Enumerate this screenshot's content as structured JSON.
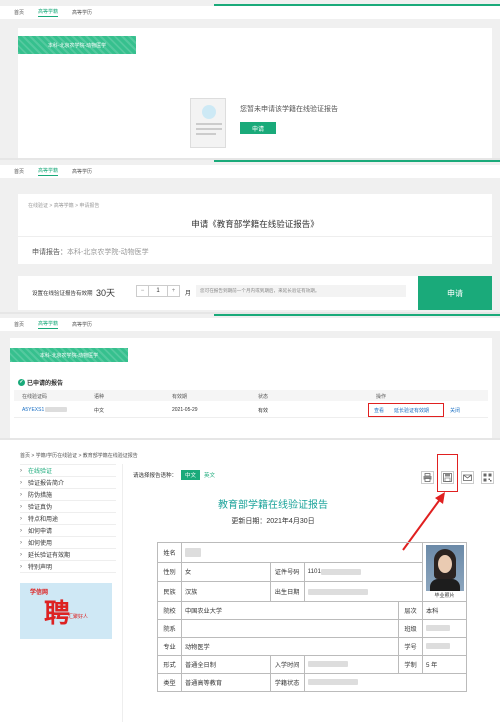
{
  "panel1": {
    "nav": [
      "首页",
      "高等学籍",
      "高等学历"
    ],
    "badge": "本科-北京农学院-动物医学",
    "empty_text": "您暂未申请该学籍在线验证报告",
    "apply_button": "申请"
  },
  "panel2": {
    "nav": [
      "首页",
      "高等学籍",
      "高等学历"
    ],
    "breadcrumb": "在线验证 > 高等学籍 > 申请报告",
    "title": "申请《教育部学籍在线验证报告》",
    "report_label": "申请报告：",
    "report_value": "本科-北京农学院-动物医学",
    "validity_label": "设置在线验证报告有效期",
    "validity_days": "30天",
    "minus": "−",
    "stepper_value": "1",
    "plus": "+",
    "unit": "月",
    "hint": "您可在报告到期前一个月内或到期后，来延长验证有效期。",
    "apply_button": "申请"
  },
  "panel3": {
    "nav": [
      "首页",
      "高等学籍",
      "高等学历"
    ],
    "badge": "本科-北京农学院-动物医学",
    "section_title": "已申请的报告",
    "headers": [
      "在线验证码",
      "语种",
      "有效期",
      "状态",
      "操作"
    ],
    "row": {
      "code": "A5YEXS1",
      "lang": "中文",
      "expiry": "2021-05-29",
      "status": "有效",
      "view": "查看",
      "extend": "延长验证有效期",
      "close": "关闭"
    }
  },
  "panel4": {
    "breadcrumb": "首页 > 学籍/学历在线验证 > 教育部学籍在线验证报告",
    "select_lang_label": "请选择报告语种：",
    "lang_cn": "中文",
    "lang_en": "英文",
    "sidebar": [
      "在线验证",
      "验证报告简介",
      "防伪措施",
      "验证真伪",
      "特点和用途",
      "如何申请",
      "如何使用",
      "延长验证有效期",
      "特别声明"
    ],
    "ad_text": "学信网",
    "ad_big": "聘",
    "ad_sub": "汇聚好人",
    "report_title": "教育部学籍在线验证报告",
    "update_date": "更新日期：2021年4月30日",
    "fields": {
      "name": "姓名",
      "gender": "性别",
      "gender_val": "女",
      "id_no": "证件号码",
      "id_val": "1101",
      "ethnic": "民族",
      "ethnic_val": "汉族",
      "birth": "出生日期",
      "school": "院校",
      "school_val": "中国农业大学",
      "level": "层次",
      "level_val": "本科",
      "dept": "院系",
      "class": "班级",
      "major": "专业",
      "major_val": "动物医学",
      "student_no": "学号",
      "form": "形式",
      "form_val": "普通全日制",
      "enroll": "入学时间",
      "duration": "学制",
      "duration_val": "5 年",
      "type": "类型",
      "type_val": "普通高等教育",
      "status": "学籍状态"
    },
    "photo_label": "毕业照片"
  }
}
